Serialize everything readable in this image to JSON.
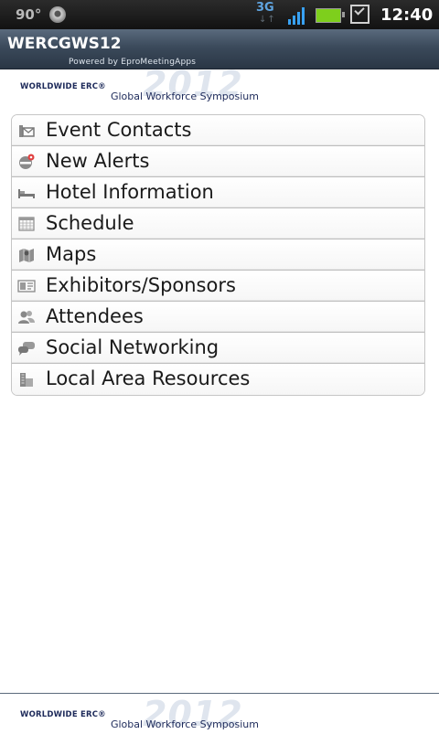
{
  "status_bar": {
    "temperature": "90°",
    "network": "3G",
    "network_arrows": "↓↑",
    "time": "12:40",
    "colors": {
      "battery": "#7ecf1c",
      "signal": "#38a1f2",
      "network": "#5fa4e0"
    }
  },
  "header": {
    "title": "WERCGWS12",
    "powered_by": "Powered by EproMeetingApps"
  },
  "banner": {
    "line1": "WORLDWIDE ERC®",
    "line2": "Global Workforce Symposium",
    "year": "2012"
  },
  "menu": {
    "items": [
      {
        "label": "Event Contacts",
        "icon": "contacts-icon"
      },
      {
        "label": "New Alerts",
        "icon": "alert-icon"
      },
      {
        "label": "Hotel Information",
        "icon": "bed-icon"
      },
      {
        "label": "Schedule",
        "icon": "calendar-icon"
      },
      {
        "label": "Maps",
        "icon": "map-icon"
      },
      {
        "label": "Exhibitors/Sponsors",
        "icon": "id-card-icon"
      },
      {
        "label": "Attendees",
        "icon": "people-icon"
      },
      {
        "label": "Social Networking",
        "icon": "chat-icon"
      },
      {
        "label": "Local Area Resources",
        "icon": "buildings-icon"
      }
    ]
  }
}
